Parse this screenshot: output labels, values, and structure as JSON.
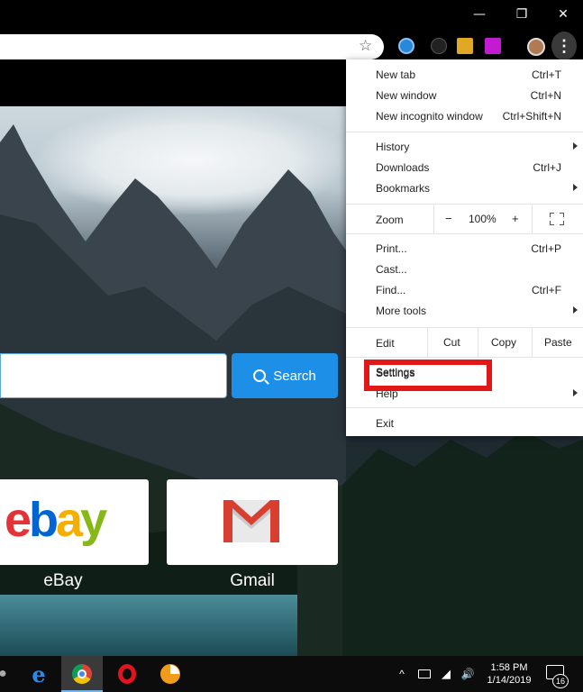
{
  "window": {
    "minimize_glyph": "—",
    "maximize_glyph": "❐",
    "close_glyph": "✕"
  },
  "toolbar": {
    "bookmark_icon": "star-icon",
    "menu_glyph": "⋮"
  },
  "page": {
    "search_button_label": "Search",
    "tiles": [
      {
        "label": "eBay"
      },
      {
        "label": "Gmail"
      }
    ],
    "ebay_letters": [
      "e",
      "b",
      "a",
      "y"
    ],
    "ebay_colors": [
      "#e53238",
      "#0064d2",
      "#f5af02",
      "#86b817"
    ],
    "gmail_colors": [
      "#d93f31",
      "#c2c2c2"
    ]
  },
  "menu": {
    "items": [
      {
        "label": "New tab",
        "shortcut": "Ctrl+T"
      },
      {
        "label": "New window",
        "shortcut": "Ctrl+N"
      },
      {
        "label": "New incognito window",
        "shortcut": "Ctrl+Shift+N"
      },
      {
        "label": "History",
        "shortcut": ""
      },
      {
        "label": "Downloads",
        "shortcut": "Ctrl+J"
      },
      {
        "label": "Bookmarks",
        "shortcut": ""
      },
      {
        "label": "Print...",
        "shortcut": "Ctrl+P"
      },
      {
        "label": "Cast...",
        "shortcut": ""
      },
      {
        "label": "Find...",
        "shortcut": "Ctrl+F"
      },
      {
        "label": "More tools",
        "shortcut": ""
      },
      {
        "label": "Settings",
        "shortcut": ""
      },
      {
        "label": "Help",
        "shortcut": ""
      },
      {
        "label": "Exit",
        "shortcut": ""
      }
    ],
    "zoom": {
      "label": "Zoom",
      "minus": "−",
      "value": "100%",
      "plus": "+"
    },
    "edit": {
      "label": "Edit",
      "cut": "Cut",
      "copy": "Copy",
      "paste": "Paste"
    },
    "highlight_color": "#e01818"
  },
  "taskbar": {
    "tray_caret": "^",
    "volume_glyph": "🔊",
    "time": "1:58 PM",
    "date": "1/14/2019",
    "notification_count": "16"
  }
}
